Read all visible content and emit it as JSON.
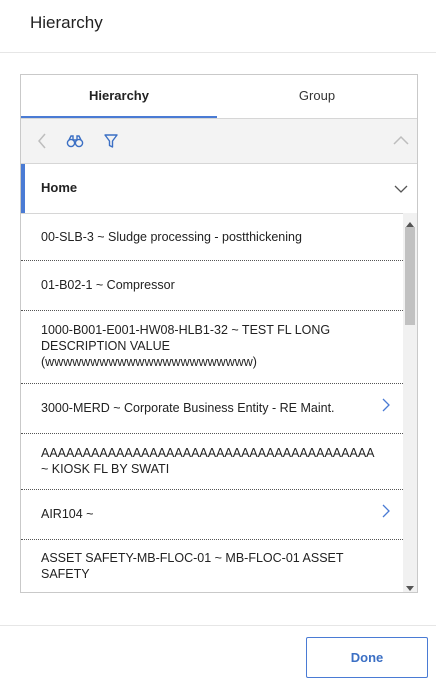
{
  "header": {
    "title": "Hierarchy"
  },
  "tabs": [
    {
      "label": "Hierarchy",
      "active": true
    },
    {
      "label": "Group",
      "active": false
    }
  ],
  "toolbar": {
    "icons": [
      "back-chevron-icon",
      "binoculars-icon",
      "filter-icon",
      "collapse-chevron-icon"
    ]
  },
  "home": {
    "label": "Home"
  },
  "items": [
    {
      "text": "00-SLB-3 ~ Sludge processing - postthickening",
      "has_children": false
    },
    {
      "text": "01-B02-1 ~ Compressor",
      "has_children": false
    },
    {
      "text": "1000-B001-E001-HW08-HLB1-32 ~ TEST FL LONG DESCRIPTION VALUE (wwwwwwwwwwwwwwwwwwwwwww)",
      "has_children": false
    },
    {
      "text": "3000-MERD ~ Corporate Business Entity - RE Maint.",
      "has_children": true
    },
    {
      "text": "AAAAAAAAAAAAAAAAAAAAAAAAAAAAAAAAAAAAAAAA ~ KIOSK FL BY SWATI",
      "has_children": false
    },
    {
      "text": "AIR104 ~",
      "has_children": true
    },
    {
      "text": "ASSET SAFETY-MB-FLOC-01 ~ MB-FLOC-01 ASSET SAFETY",
      "has_children": false
    }
  ],
  "footer": {
    "done_label": "Done"
  },
  "colors": {
    "accent": "#4a7bd4",
    "icon": "#3b6fc4"
  }
}
